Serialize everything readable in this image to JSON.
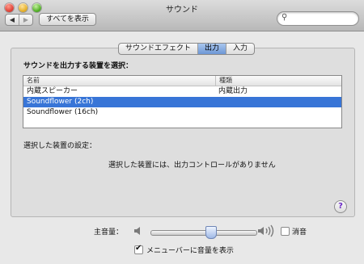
{
  "window": {
    "title": "サウンド"
  },
  "toolbar": {
    "back_icon": "◀",
    "forward_icon": "▶",
    "show_all": "すべてを表示",
    "search_placeholder": ""
  },
  "tabs": [
    {
      "label": "サウンドエフェクト",
      "selected": false
    },
    {
      "label": "出力",
      "selected": true
    },
    {
      "label": "入力",
      "selected": false
    }
  ],
  "output": {
    "select_device_label": "サウンドを出力する装置を選択：",
    "columns": [
      "名前",
      "種類"
    ],
    "devices": [
      {
        "name": "内蔵スピーカー",
        "type": "内蔵出力",
        "selected": false
      },
      {
        "name": "Soundflower (2ch)",
        "type": "",
        "selected": true
      },
      {
        "name": "Soundflower (16ch)",
        "type": "",
        "selected": false
      }
    ],
    "selected_settings_label": "選択した装置の設定：",
    "no_controls_message": "選択した装置には、出力コントロールがありません"
  },
  "help": {
    "label": "?"
  },
  "volume": {
    "label": "主音量：",
    "level_fraction": 0.58,
    "mute_label": "消音",
    "mute_checked": false
  },
  "menu_bar_option": {
    "label": "メニューバーに音量を表示",
    "checked": true
  },
  "colors": {
    "selection": "#3875d7",
    "help_purple": "#6a28c6"
  }
}
